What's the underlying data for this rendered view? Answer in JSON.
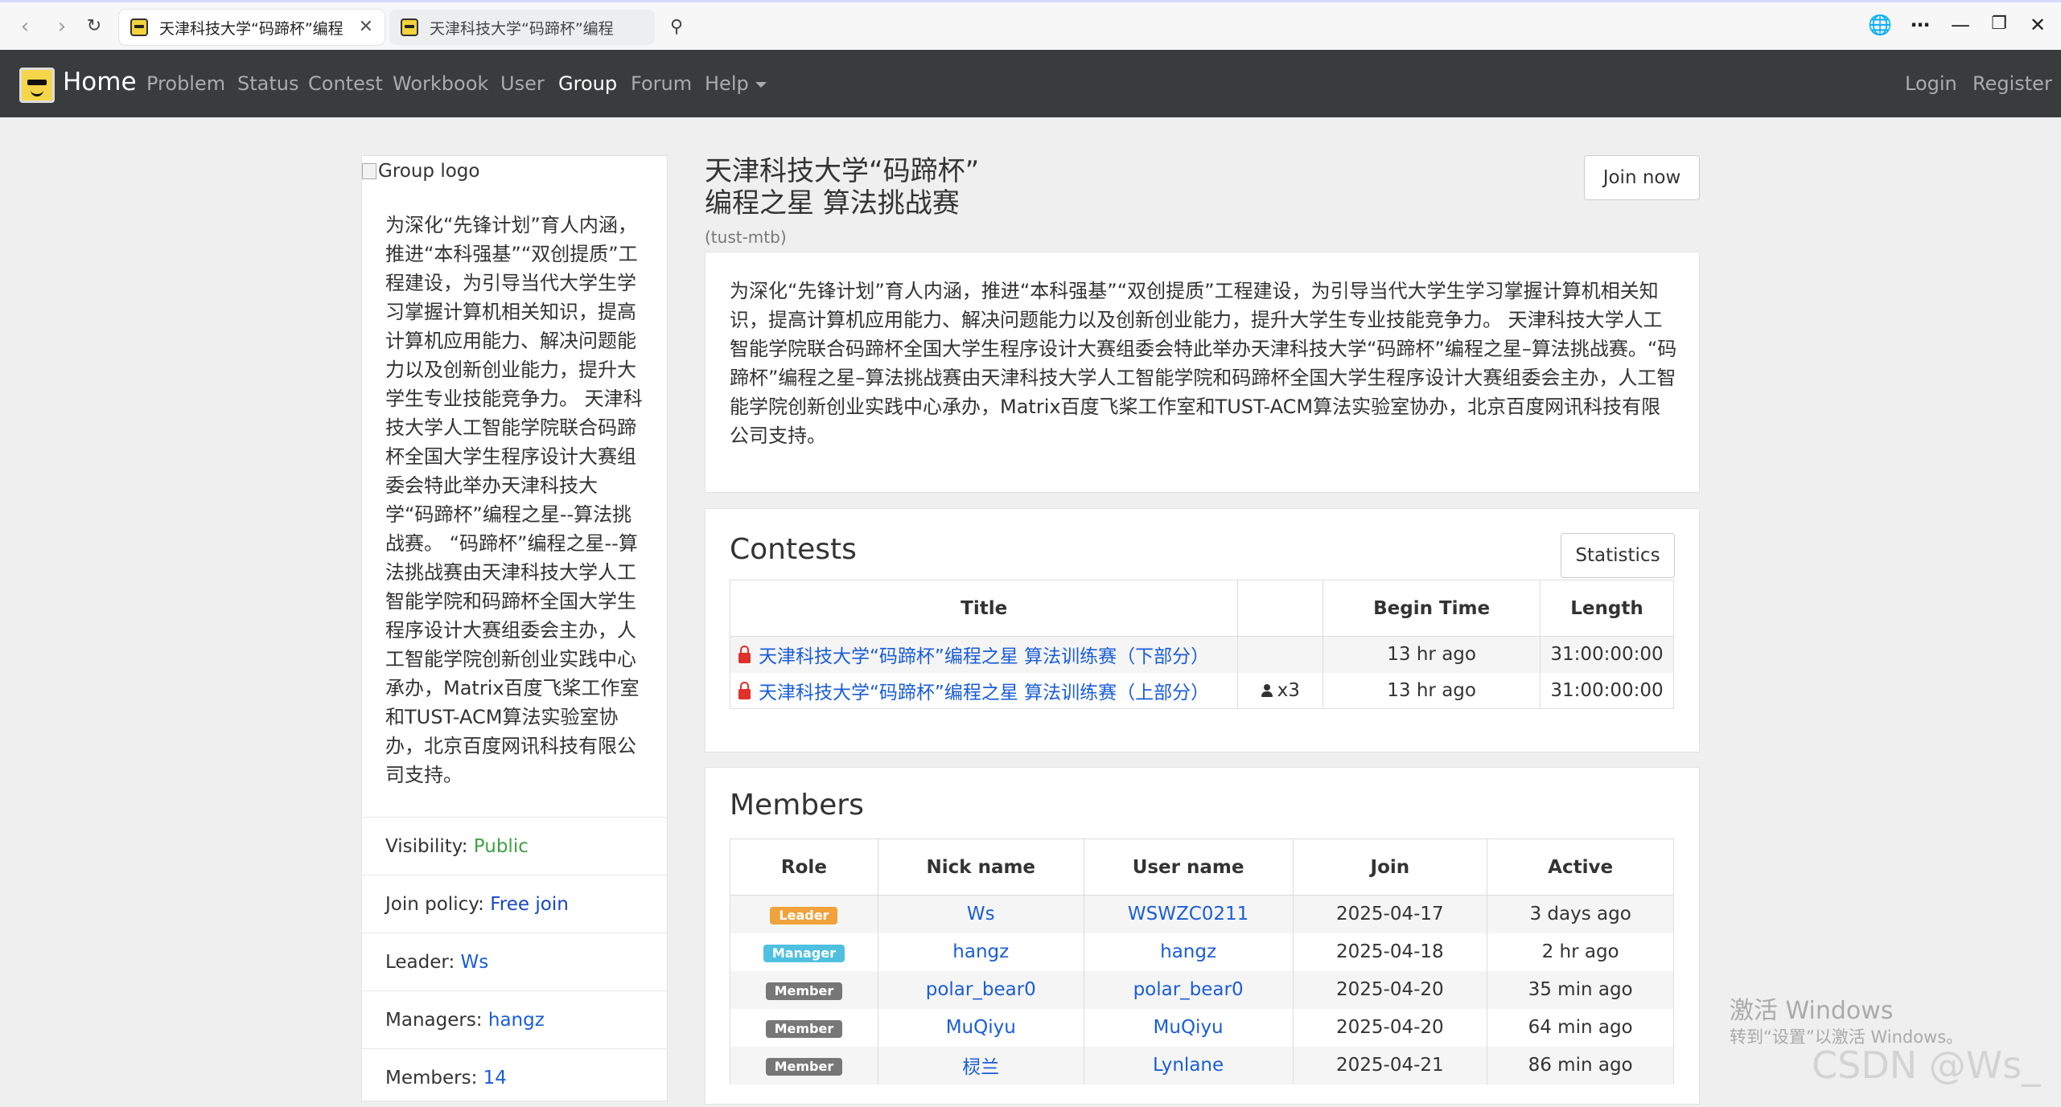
{
  "browser": {
    "tabs": [
      {
        "title": "天津科技大学“码蹄杯”编程之星 算法挑战赛 - Vjudge"
      },
      {
        "title": "天津科技大学“码蹄杯”编程之星 算法挑战赛 - Vjudge"
      }
    ],
    "icons": {
      "back": "back-icon",
      "forward": "forward-icon",
      "reload": "reload-icon",
      "search": "search-icon",
      "translate": "globe-icon",
      "more": "more-icon",
      "minimize": "minimize-icon",
      "restore": "restore-icon",
      "close": "close-icon"
    }
  },
  "navbar": {
    "brand": "Home",
    "items": [
      "Problem",
      "Status",
      "Contest",
      "Workbook",
      "User",
      "Group",
      "Forum",
      "Help"
    ],
    "active": "Group",
    "login": "Login",
    "register": "Register"
  },
  "sidebar": {
    "logo_alt": "Group logo",
    "description": "为深化“先锋计划”育人内涵，推进“本科强基”“双创提质”工程建设，为引导当代大学生学习掌握计算机相关知识，提高计算机应用能力、解决问题能力以及创新创业能力，提升大学生专业技能竞争力。 天津科技大学人工智能学院联合码蹄杯全国大学生程序设计大赛组委会特此举办天津科技大学“码蹄杯”编程之星--算法挑战赛。 “码蹄杯”编程之星--算法挑战赛由天津科技大学人工智能学院和码蹄杯全国大学生程序设计大赛组委会主办，人工智能学院创新创业实践中心承办，Matrix百度飞桨工作室和TUST-ACM算法实验室协办，北京百度网讯科技有限公司支持。",
    "visibility_label": "Visibility:",
    "visibility_value": "Public",
    "join_policy_label": "Join policy:",
    "join_policy_value": "Free join",
    "leader_label": "Leader:",
    "leader_value": "Ws",
    "managers_label": "Managers:",
    "managers_value": "hangz",
    "members_label": "Members:",
    "members_value": "14"
  },
  "group": {
    "title_line1": "天津科技大学“码蹄杯”",
    "title_line2": "编程之星 算法挑战赛",
    "slug": "(tust-mtb)",
    "join_button": "Join now",
    "description": "为深化“先锋计划”育人内涵，推进“本科强基”“双创提质”工程建设，为引导当代大学生学习掌握计算机相关知识，提高计算机应用能力、解决问题能力以及创新创业能力，提升大学生专业技能竞争力。 天津科技大学人工智能学院联合码蹄杯全国大学生程序设计大赛组委会特此举办天津科技大学“码蹄杯”编程之星–算法挑战赛。“码蹄杯”编程之星–算法挑战赛由天津科技大学人工智能学院和码蹄杯全国大学生程序设计大赛组委会主办，人工智能学院创新创业实践中心承办，Matrix百度飞桨工作室和TUST-ACM算法实验室协办，北京百度网讯科技有限公司支持。"
  },
  "contests": {
    "heading": "Contests",
    "statistics_button": "Statistics",
    "columns": [
      "Title",
      "",
      "Begin Time",
      "Length"
    ],
    "rows": [
      {
        "title": "天津科技大学“码蹄杯”编程之星 算法训练赛（下部分）",
        "participants": "",
        "begin": "13 hr ago",
        "length": "31:00:00:00"
      },
      {
        "title": "天津科技大学“码蹄杯”编程之星 算法训练赛（上部分）",
        "participants": "x3",
        "begin": "13 hr ago",
        "length": "31:00:00:00"
      }
    ]
  },
  "members": {
    "heading": "Members",
    "columns": [
      "Role",
      "Nick name",
      "User name",
      "Join",
      "Active"
    ],
    "rows": [
      {
        "role": "Leader",
        "nick": "Ws",
        "user": "WSWZC0211",
        "join": "2025-04-17",
        "active": "3 days ago"
      },
      {
        "role": "Manager",
        "nick": "hangz",
        "user": "hangz",
        "join": "2025-04-18",
        "active": "2 hr ago"
      },
      {
        "role": "Member",
        "nick": "polar_bear0",
        "user": "polar_bear0",
        "join": "2025-04-20",
        "active": "35 min ago"
      },
      {
        "role": "Member",
        "nick": "MuQiyu",
        "user": "MuQiyu",
        "join": "2025-04-20",
        "active": "64 min ago"
      },
      {
        "role": "Member",
        "nick": "棂兰",
        "user": "Lynlane",
        "join": "2025-04-21",
        "active": "86 min ago"
      }
    ]
  },
  "overlay": {
    "activate_title": "激活 Windows",
    "activate_sub": "转到“设置”以激活 Windows。",
    "csdn_watermark": "CSDN @Ws_"
  },
  "colors": {
    "navbar": "#3a3b3c",
    "link": "#1a5dd8",
    "public_green": "#3ea244",
    "time_red": "#e0312b",
    "leader_badge": "#f0a23b",
    "manager_badge": "#4fc0df",
    "member_badge": "#777777"
  }
}
